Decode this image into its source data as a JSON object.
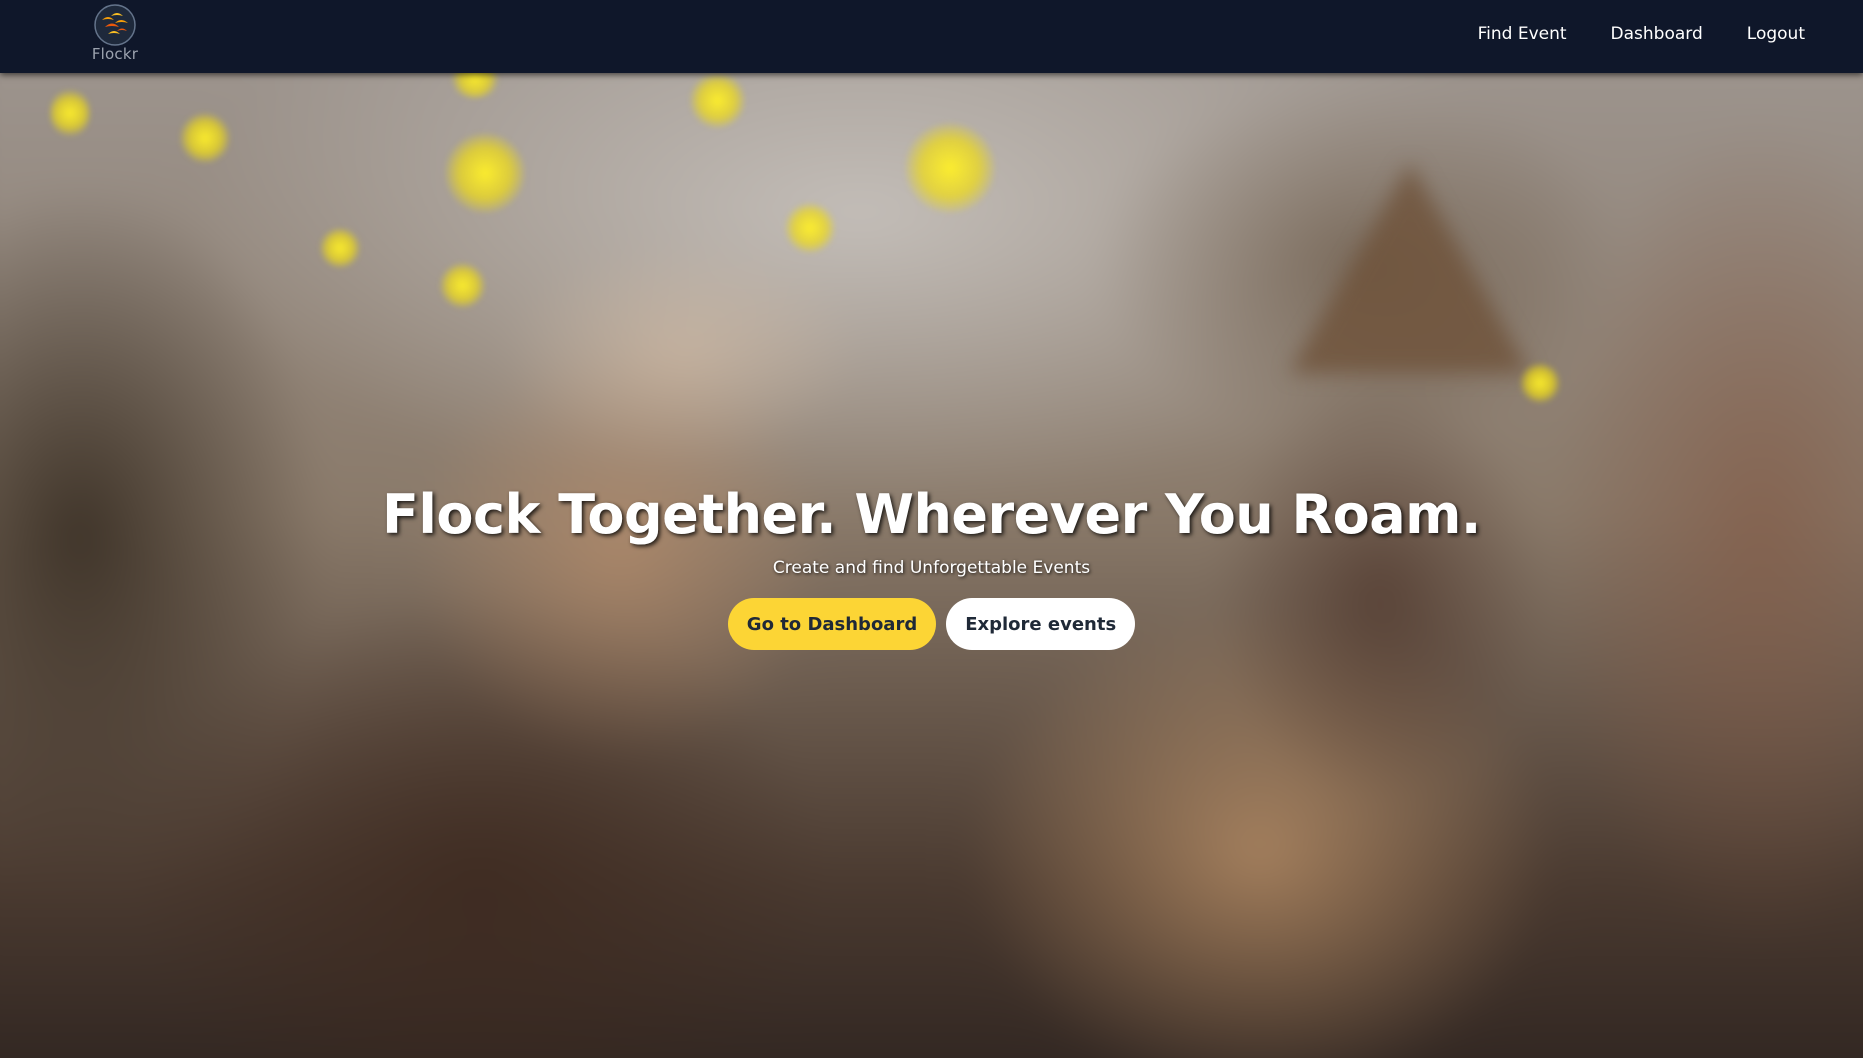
{
  "brand": {
    "name": "Flockr",
    "icon": "flockr-birds-logo-icon"
  },
  "nav": {
    "links": [
      {
        "label": "Find Event"
      },
      {
        "label": "Dashboard"
      },
      {
        "label": "Logout"
      }
    ]
  },
  "hero": {
    "title": "Flock Together. Wherever You Roam.",
    "subtitle": "Create and find Unforgettable Events",
    "primary_button": "Go to Dashboard",
    "secondary_button": "Explore events",
    "background": "blurred-party-photo"
  },
  "colors": {
    "navbar": "#0f172a",
    "accent": "#fcd535",
    "text": "#ffffff",
    "button_text": "#1f2937"
  }
}
